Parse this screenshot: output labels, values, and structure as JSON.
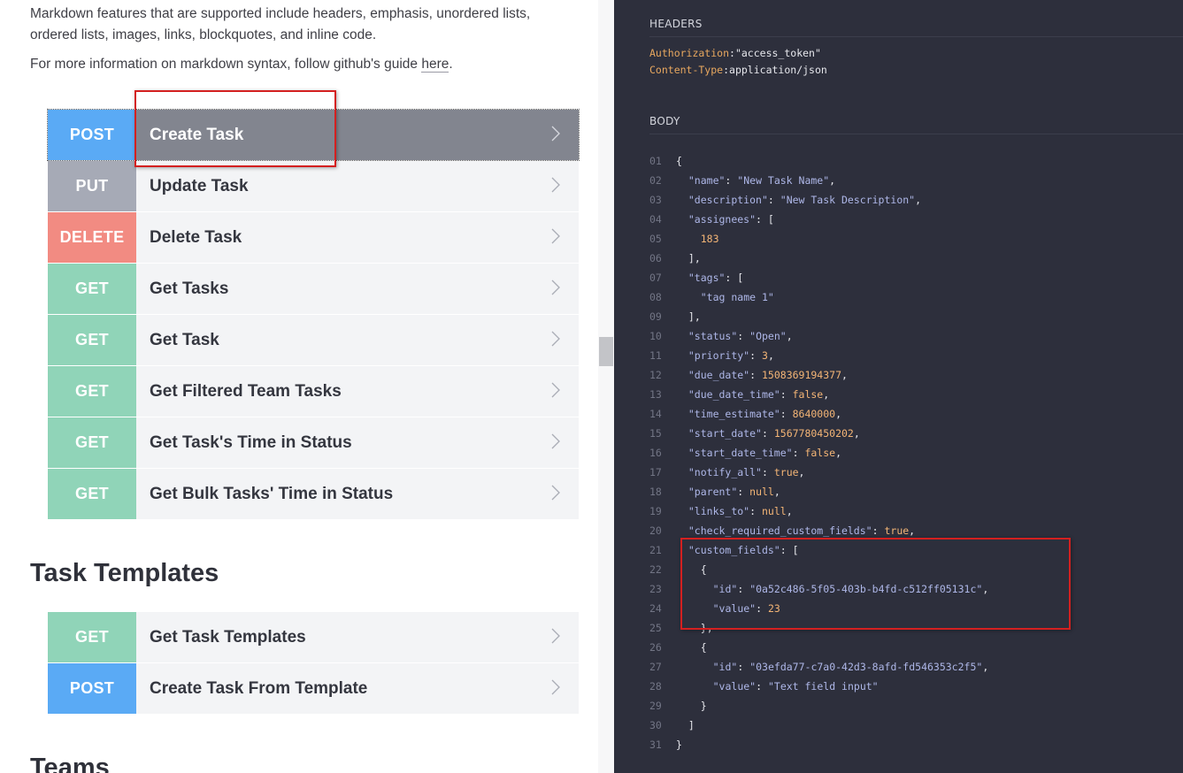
{
  "intro": {
    "p1": "Markdown features that are supported include headers, emphasis, unordered lists, ordered lists, images, links, blockquotes, and inline code.",
    "p2_prefix": "For more information on markdown syntax, follow github's guide ",
    "p2_link": "here",
    "p2_suffix": "."
  },
  "tasks_endpoints": [
    {
      "method": "POST",
      "title": "Create Task"
    },
    {
      "method": "PUT",
      "title": "Update Task"
    },
    {
      "method": "DELETE",
      "title": "Delete Task"
    },
    {
      "method": "GET",
      "title": "Get Tasks"
    },
    {
      "method": "GET",
      "title": "Get Task"
    },
    {
      "method": "GET",
      "title": "Get Filtered Team Tasks"
    },
    {
      "method": "GET",
      "title": "Get Task's Time in Status"
    },
    {
      "method": "GET",
      "title": "Get Bulk Tasks' Time in Status"
    }
  ],
  "task_templates": {
    "heading": "Task Templates",
    "endpoints": [
      {
        "method": "GET",
        "title": "Get Task Templates"
      },
      {
        "method": "POST",
        "title": "Create Task From Template"
      }
    ]
  },
  "teams": {
    "heading": "Teams"
  },
  "method_colors": {
    "POST": "#5aaaf5",
    "PUT": "#a6aab6",
    "DELETE": "#f28b82",
    "GET": "#90d4b8"
  },
  "icons": {
    "chevron": "chevron-right-icon"
  },
  "request": {
    "headers_label": "HEADERS",
    "headers": [
      {
        "key": "Authorization",
        "value": "\"access_token\""
      },
      {
        "key": "Content-Type",
        "value": "application/json"
      }
    ],
    "body_label": "BODY",
    "body_lines": [
      "{",
      "  \"name\": \"New Task Name\",",
      "  \"description\": \"New Task Description\",",
      "  \"assignees\": [",
      "    183",
      "  ],",
      "  \"tags\": [",
      "    \"tag name 1\"",
      "  ],",
      "  \"status\": \"Open\",",
      "  \"priority\": 3,",
      "  \"due_date\": 1508369194377,",
      "  \"due_date_time\": false,",
      "  \"time_estimate\": 8640000,",
      "  \"start_date\": 1567780450202,",
      "  \"start_date_time\": false,",
      "  \"notify_all\": true,",
      "  \"parent\": null,",
      "  \"links_to\": null,",
      "  \"check_required_custom_fields\": true,",
      "  \"custom_fields\": [",
      "    {",
      "      \"id\": \"0a52c486-5f05-403b-b4fd-c512ff05131c\",",
      "      \"value\": 23",
      "    },",
      "    {",
      "      \"id\": \"03efda77-c7a0-42d3-8afd-fd546353c2f5\",",
      "      \"value\": \"Text field input\"",
      "    }",
      "  ]",
      "}"
    ]
  }
}
